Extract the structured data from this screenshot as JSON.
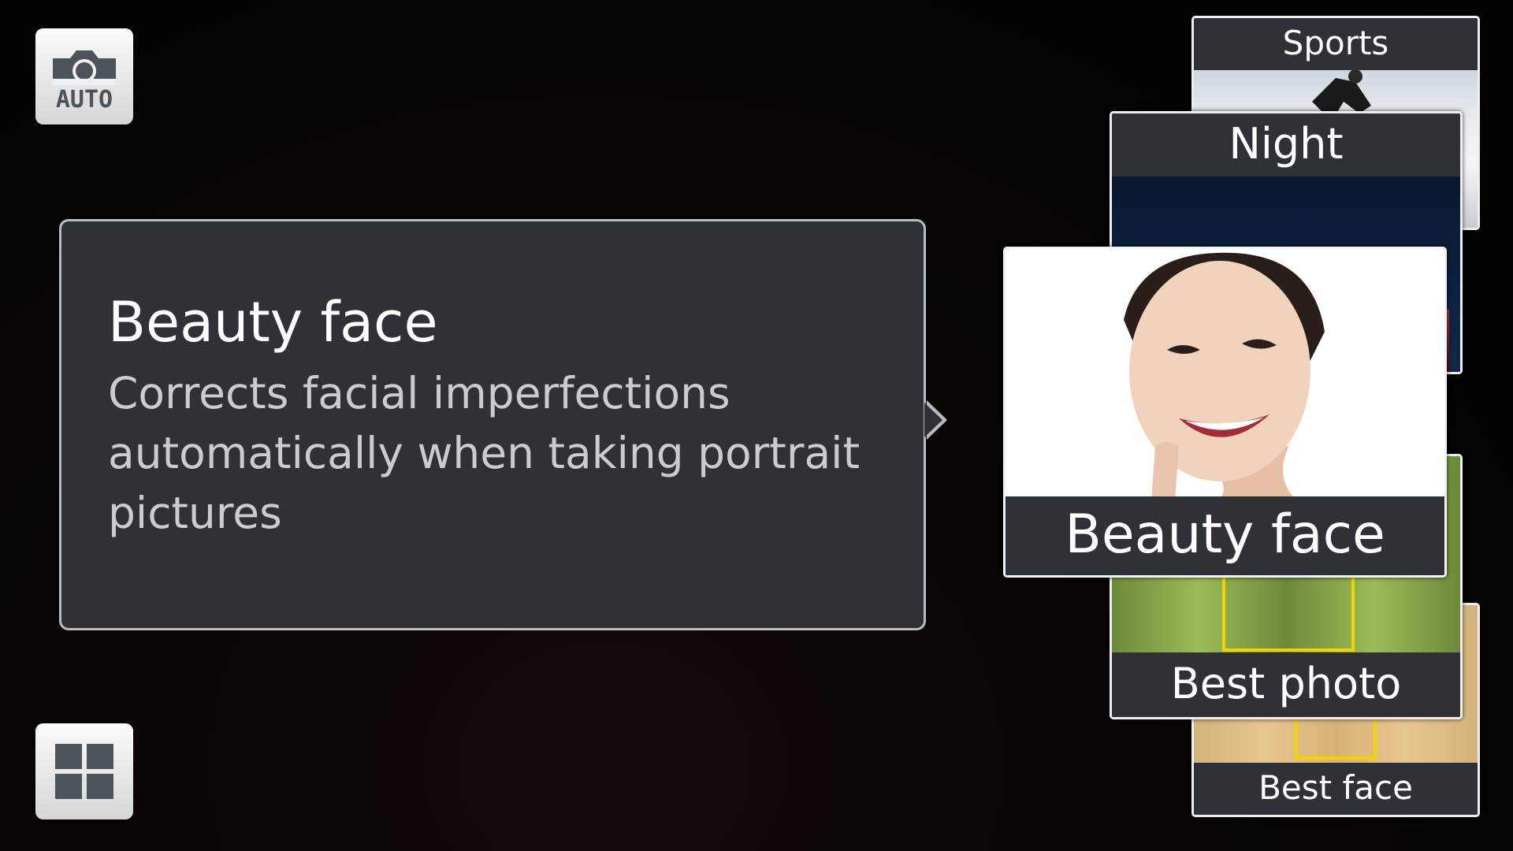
{
  "mode_button": {
    "label": "AUTO",
    "icon": "camera-auto-icon"
  },
  "grid_button": {
    "icon": "grid-icon"
  },
  "description": {
    "title": "Beauty face",
    "body": "Corrects facial imperfections automatically when taking portrait pictures"
  },
  "modes": [
    {
      "id": "sports",
      "label": "Sports"
    },
    {
      "id": "night",
      "label": "Night"
    },
    {
      "id": "beauty-face",
      "label": "Beauty face",
      "selected": true
    },
    {
      "id": "best-photo",
      "label": "Best photo"
    },
    {
      "id": "best-face",
      "label": "Best face"
    }
  ],
  "colors": {
    "panel_bg": "#2e3135",
    "panel_border": "#b9bcc0",
    "selection_frame": "#f3d200",
    "background": "#020202"
  }
}
